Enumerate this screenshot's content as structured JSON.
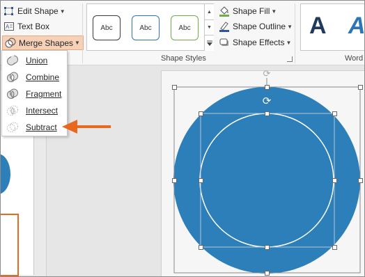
{
  "ribbon": {
    "edit_shape": "Edit Shape",
    "text_box": "Text Box",
    "merge_shapes": "Merge Shapes",
    "shape_style_sample": "Abc",
    "shape_fill": "Shape Fill",
    "shape_outline": "Shape Outline",
    "shape_effects": "Shape Effects",
    "shape_styles_group": "Shape Styles",
    "wordart_group": "Word",
    "wordart_sample": "A"
  },
  "merge_menu": {
    "items": [
      {
        "label": "Union",
        "icon": "union-icon"
      },
      {
        "label": "Combine",
        "icon": "combine-icon"
      },
      {
        "label": "Fragment",
        "icon": "fragment-icon"
      },
      {
        "label": "Intersect",
        "icon": "intersect-icon"
      },
      {
        "label": "Subtract",
        "icon": "subtract-icon"
      }
    ]
  },
  "colors": {
    "shape_fill": "#2c7fb8",
    "arrow": "#e8691e",
    "merge_highlight": "#f6d1b8",
    "thumb_outline": "#e8691e"
  }
}
